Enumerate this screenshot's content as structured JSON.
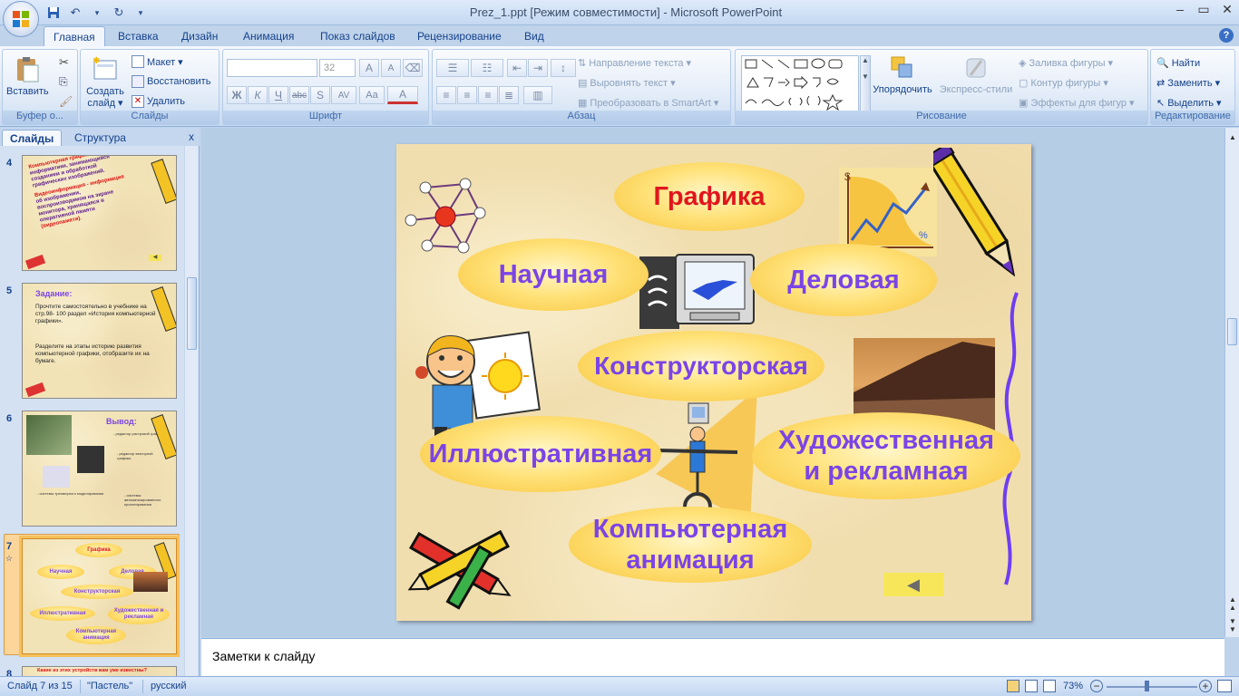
{
  "window": {
    "title": "Prez_1.ppt [Режим совместимости] - Microsoft PowerPoint",
    "controls": {
      "minimize": "–",
      "maximize": "▭",
      "close": "✕"
    }
  },
  "qat": {
    "save_icon": "save-icon",
    "undo_icon": "undo-icon",
    "redo_icon": "redo-icon"
  },
  "tabs": [
    "Главная",
    "Вставка",
    "Дизайн",
    "Анимация",
    "Показ слайдов",
    "Рецензирование",
    "Вид"
  ],
  "active_tab": "Главная",
  "ribbon": {
    "clipboard": {
      "title": "Буфер о...",
      "paste": "Вставить"
    },
    "slides": {
      "title": "Слайды",
      "create": "Создать",
      "create2": "слайд ▾",
      "layout": "Макет ▾",
      "reset": "Восстановить",
      "delete": "Удалить"
    },
    "font": {
      "title": "Шрифт",
      "font_name": "",
      "font_size": "32",
      "bold": "Ж",
      "italic": "К",
      "underline": "Ч",
      "strike": "abc",
      "shadow": "S",
      "spacing": "AV",
      "case": "Aa",
      "color": "A",
      "grow": "A",
      "shrink": "A"
    },
    "paragraph": {
      "title": "Абзац",
      "text_direction": "Направление текста",
      "align_text": "Выровнять текст",
      "smartart": "Преобразовать в SmartArt"
    },
    "drawing": {
      "title": "Рисование",
      "arrange": "Упорядочить",
      "quick_styles": "Экспресс-стили",
      "fill": "Заливка фигуры",
      "outline": "Контур фигуры",
      "effects": "Эффекты для фигур"
    },
    "editing": {
      "title": "Редактирование",
      "find": "Найти",
      "replace": "Заменить",
      "select": "Выделить"
    }
  },
  "panel": {
    "tab_slides": "Слайды",
    "tab_outline": "Структура",
    "close": "x",
    "thumbs": [
      {
        "num": "4",
        "line1": "Компьютерная графика - раздел",
        "line2": "информатики, занимающийся",
        "line3": "созданием и обработкой",
        "line4": "графических изображений.",
        "line5": "Видеоинформация - информация",
        "line6": "об изображении,",
        "line7": "воспроизводимом на экране",
        "line8": "монитора, хранящаяся в",
        "line9": "оперативной памяти",
        "line10": "(видеопамяти)."
      },
      {
        "num": "5",
        "title": "Задание:",
        "text1": "Прочтите самостоятельно в учебнике на стр.98- 100 раздел «История компьютерной графики».",
        "text2": "Разделите на этапы историю развития компьютерной графики, отобразите их на бумаге."
      },
      {
        "num": "6",
        "title": "Вывод:",
        "t1": "- редактор растровой графики",
        "t2": "- редактор векторной графики",
        "t3": "- системы трехмерного моделирования",
        "t4": "- системы автоматизированного проектирования"
      },
      {
        "num": "7",
        "ovals": [
          "Графика",
          "Научная",
          "Деловая",
          "Конструкторская",
          "Иллюстративная",
          "Художественная и рекламная",
          "Компьютерная анимация"
        ]
      },
      {
        "num": "8",
        "text": "Какие из этих устройств вам уже известны?"
      }
    ]
  },
  "slide": {
    "ovals": {
      "grafika": "Графика",
      "nauchnaya": "Научная",
      "delovaya": "Деловая",
      "konstruktorskaya": "Конструкторская",
      "illyustrativnaya": "Иллюстративная",
      "hud1": "Художественная",
      "hud2": "и рекламная",
      "anim1": "Компьютерная",
      "anim2": "анимация"
    },
    "chart_icon_labels": {
      "dollar": "$",
      "percent": "%"
    },
    "back_button": "◀"
  },
  "notes": {
    "placeholder": "Заметки к слайду"
  },
  "status": {
    "slide": "Слайд 7 из 15",
    "theme": "\"Пастель\"",
    "language": "русский",
    "zoom": "73%"
  },
  "colors": {
    "accent": "#15428b",
    "oval_text": "#7b44e6",
    "oval_title_text": "#e0161d",
    "oval_fill": "#ffe27a",
    "slide_bg": "#f1deaf"
  }
}
